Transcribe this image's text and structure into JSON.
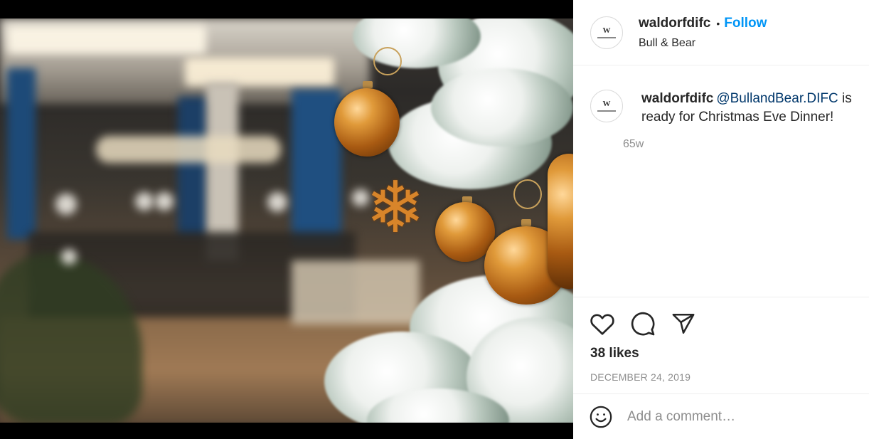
{
  "post": {
    "author": {
      "username": "waldorfdifc",
      "location": "Bull & Bear",
      "follow_label": "Follow",
      "separator": "•"
    },
    "caption": {
      "username": "waldorfdifc",
      "mention": "@BullandBear.DIFC",
      "text": " is ready for Christmas Eve Dinner!",
      "age": "65w"
    },
    "actions": {
      "like_icon": "heart-icon",
      "comment_icon": "comment-bubble-icon",
      "share_icon": "paper-plane-icon"
    },
    "likes": "38 likes",
    "date": "DECEMBER 24, 2019",
    "comment": {
      "placeholder": "Add a comment…",
      "emoji_icon": "smiley-icon"
    }
  },
  "colors": {
    "follow": "#0095f6",
    "mention": "#00376b",
    "muted": "#8e8e8e",
    "divider": "#efefef"
  }
}
